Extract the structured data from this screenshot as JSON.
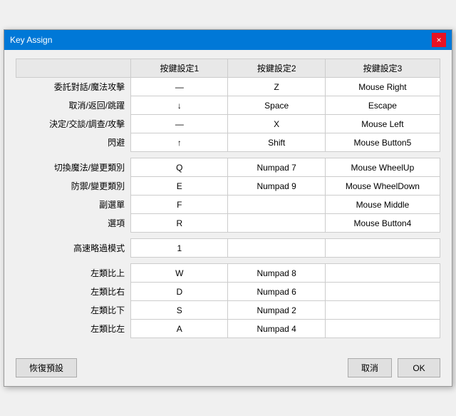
{
  "window": {
    "title": "Key Assign",
    "close_label": "×"
  },
  "table": {
    "headers": [
      "",
      "按鍵設定1",
      "按鍵設定2",
      "按鍵設定3"
    ],
    "groups": [
      {
        "rows": [
          {
            "label": "委託對話/魔法攻擊",
            "col1": "—",
            "col2": "Z",
            "col3": "Mouse Right"
          },
          {
            "label": "取消/返回/跳躍",
            "col1": "↓",
            "col2": "Space",
            "col3": "Escape"
          },
          {
            "label": "決定/交談/調查/攻擊",
            "col1": "—",
            "col2": "X",
            "col3": "Mouse Left"
          },
          {
            "label": "閃避",
            "col1": "↑",
            "col2": "Shift",
            "col3": "Mouse Button5"
          }
        ]
      },
      {
        "rows": [
          {
            "label": "切換魔法/變更類別",
            "col1": "Q",
            "col2": "Numpad 7",
            "col3": "Mouse WheelUp"
          },
          {
            "label": "防禦/變更類別",
            "col1": "E",
            "col2": "Numpad 9",
            "col3": "Mouse WheelDown"
          },
          {
            "label": "副選單",
            "col1": "F",
            "col2": "",
            "col3": "Mouse Middle"
          },
          {
            "label": "選項",
            "col1": "R",
            "col2": "",
            "col3": "Mouse Button4"
          }
        ]
      },
      {
        "rows": [
          {
            "label": "高速略過模式",
            "col1": "1",
            "col2": "",
            "col3": ""
          }
        ]
      },
      {
        "rows": [
          {
            "label": "左類比上",
            "col1": "W",
            "col2": "Numpad 8",
            "col3": ""
          },
          {
            "label": "左類比右",
            "col1": "D",
            "col2": "Numpad 6",
            "col3": ""
          },
          {
            "label": "左類比下",
            "col1": "S",
            "col2": "Numpad 2",
            "col3": ""
          },
          {
            "label": "左類比左",
            "col1": "A",
            "col2": "Numpad 4",
            "col3": ""
          }
        ]
      }
    ]
  },
  "footer": {
    "restore_label": "恢復預設",
    "cancel_label": "取消",
    "ok_label": "OK"
  }
}
